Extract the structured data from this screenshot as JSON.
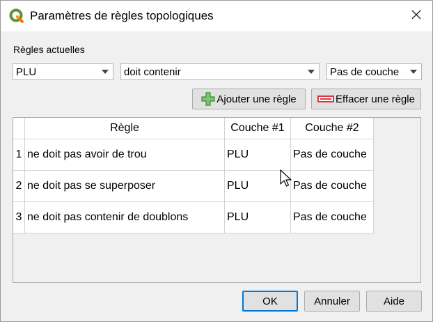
{
  "window": {
    "title": "Paramètres de règles topologiques",
    "app_icon": "qgis-logo-icon",
    "close_icon": "close-icon"
  },
  "rules_section": {
    "label": "Règles actuelles",
    "layer_combo": {
      "value": "PLU"
    },
    "rule_combo": {
      "value": "doit contenir"
    },
    "target_layer_combo": {
      "value": "Pas de couche"
    }
  },
  "actions": {
    "add_rule": {
      "label": "Ajouter une règle",
      "icon": "plus-icon",
      "color": "#3aa33a"
    },
    "delete_rule": {
      "label": "Effacer une règle",
      "icon": "minus-icon",
      "color": "#d9363e"
    }
  },
  "table": {
    "columns": [
      "Règle",
      "Couche #1",
      "Couche #2"
    ],
    "rows": [
      {
        "num": "1",
        "rule": "ne doit pas avoir de trou",
        "layer1": "PLU",
        "layer2": "Pas de couche"
      },
      {
        "num": "2",
        "rule": "ne doit pas se superposer",
        "layer1": "PLU",
        "layer2": "Pas de couche"
      },
      {
        "num": "3",
        "rule": "ne doit pas contenir de doublons",
        "layer1": "PLU",
        "layer2": "Pas de couche"
      }
    ]
  },
  "footer": {
    "ok": "OK",
    "cancel": "Annuler",
    "help": "Aide"
  },
  "colors": {
    "accent": "#0078d7",
    "qgis_green": "#589632",
    "qgis_yellow": "#ee7913"
  }
}
